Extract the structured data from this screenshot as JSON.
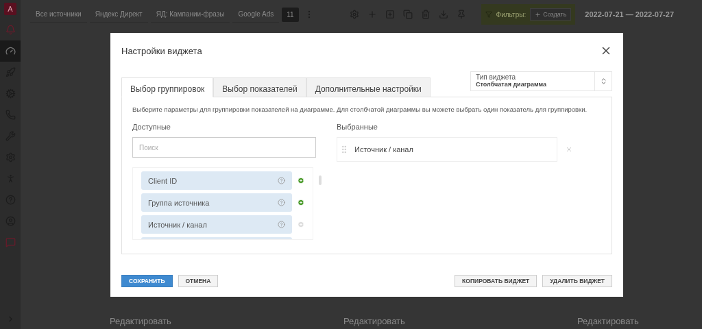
{
  "sidebar": {
    "logo": "A",
    "items": [
      {
        "selected": false
      },
      {
        "selected": true
      },
      {
        "selected": false
      },
      {
        "selected": false
      },
      {
        "selected": false
      },
      {
        "selected": false
      },
      {
        "selected": false
      },
      {
        "selected": false
      },
      {
        "selected": false
      },
      {
        "selected": false
      },
      {
        "selected": false
      }
    ]
  },
  "toolbar": {
    "source_tabs": [
      {
        "label": "Все источники",
        "selected": false
      },
      {
        "label": "Яндекс Директ",
        "selected": false
      },
      {
        "label": "ЯД: Кампании-фразы",
        "selected": false
      },
      {
        "label": "Google Ads",
        "selected": false
      }
    ],
    "counter": "11",
    "filter_label": "Фильтры:",
    "create_button": "Создать",
    "date_range": "2022-07-21 — 2022-07-27"
  },
  "background_cards": [
    {
      "action": "Редактировать"
    },
    {
      "action": "Редактировать"
    },
    {
      "action": "Редактировать"
    }
  ],
  "modal": {
    "title": "Настройки виджета",
    "tabs": [
      {
        "label": "Выбор группировок",
        "selected": true
      },
      {
        "label": "Выбор показателей",
        "selected": false
      },
      {
        "label": "Дополнительные настройки",
        "selected": false
      }
    ],
    "widget_type": {
      "label": "Тип виджета",
      "value": "Столбчатая диаграмма"
    },
    "hint": "Выберите параметры для группировки показателей на диаграмме. Для столбчатой диаграммы вы можете выбрать один показатель для группировки.",
    "available": {
      "title": "Доступные",
      "search_placeholder": "Поиск",
      "items": [
        {
          "label": "Client ID",
          "disabled": false
        },
        {
          "label": "Группа источника",
          "disabled": false
        },
        {
          "label": "Источник / канал",
          "disabled": true
        }
      ]
    },
    "chosen": {
      "title": "Выбранные",
      "items": [
        {
          "label": "Источник / канал"
        }
      ]
    },
    "buttons": [
      {
        "label": "СОХРАНИТЬ",
        "kind": "primary"
      },
      {
        "label": "ОТМЕНА",
        "kind": "secondary"
      },
      {
        "label": "КОПИРОВАТЬ ВИДЖЕТ",
        "kind": "secondary"
      },
      {
        "label": "УДАЛИТЬ ВИДЖЕТ",
        "kind": "secondary"
      }
    ]
  }
}
